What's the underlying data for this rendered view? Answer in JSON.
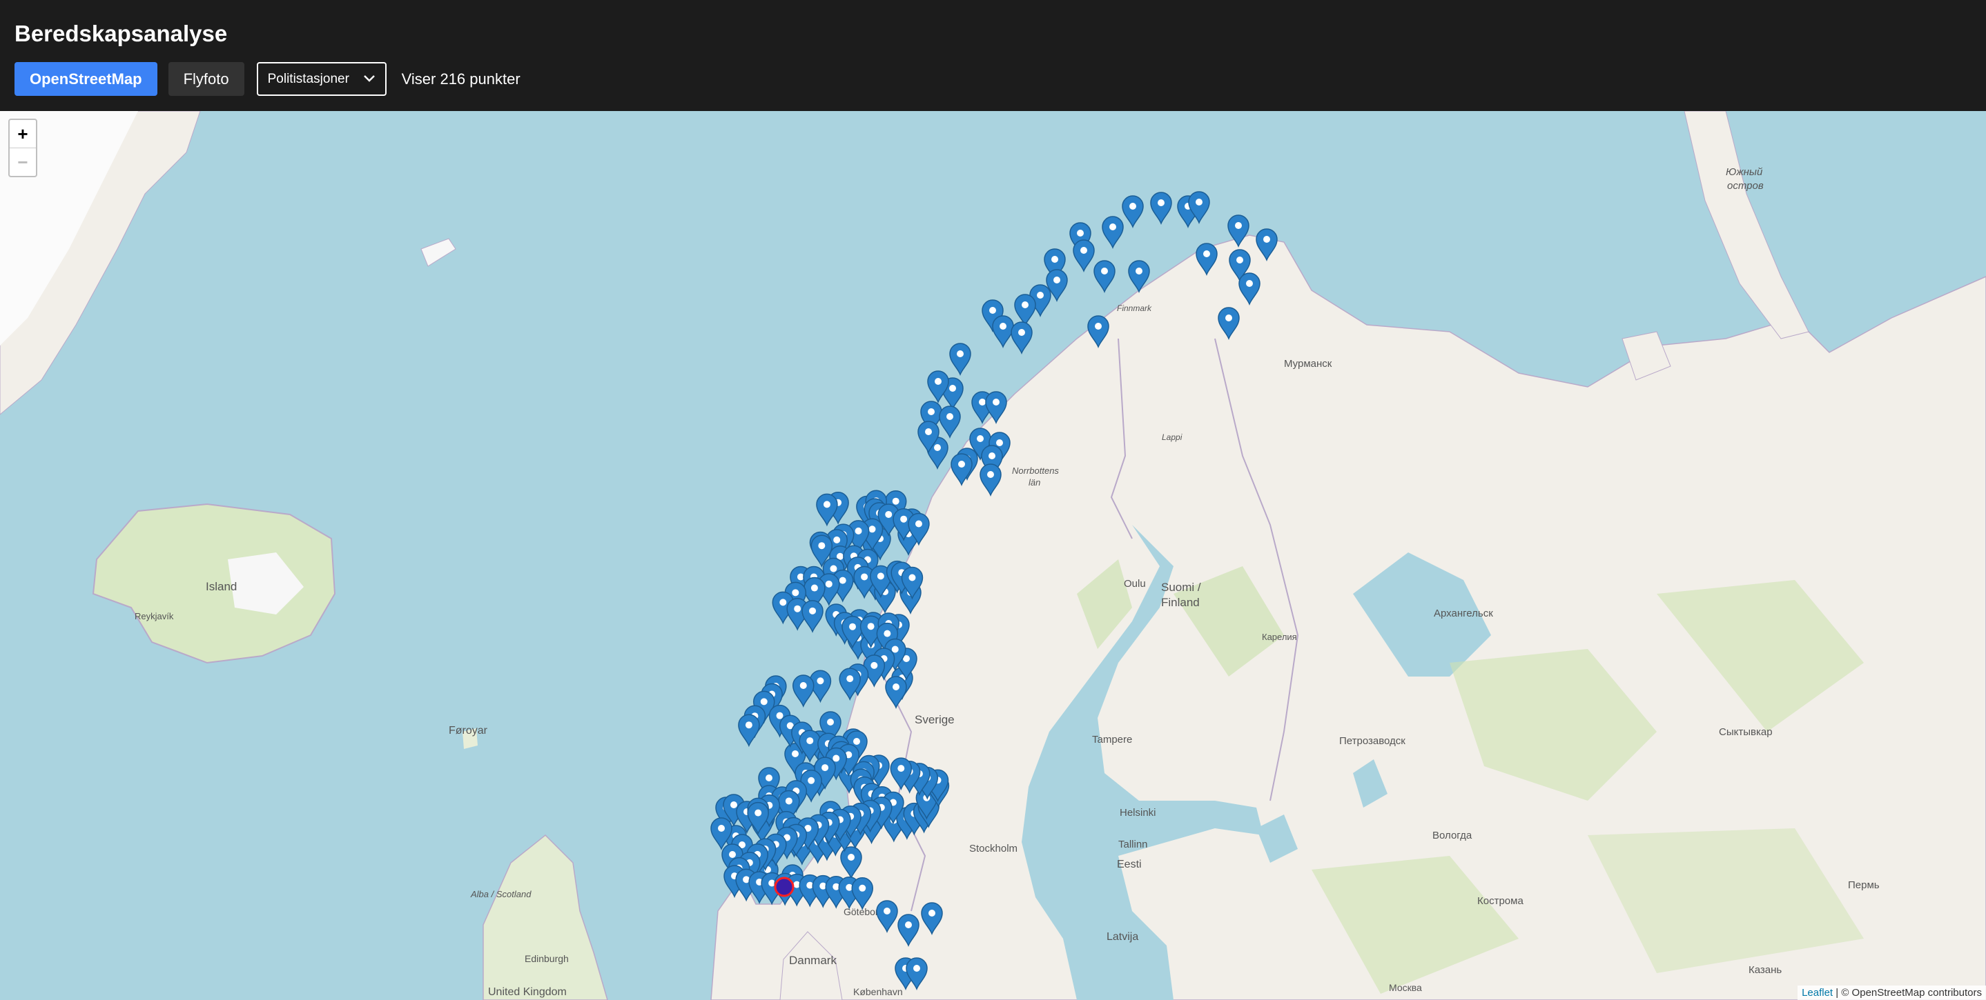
{
  "header": {
    "title": "Beredskapsanalyse",
    "btn_osm": "OpenStreetMap",
    "btn_aerial": "Flyfoto",
    "layer_select": "Politistasjoner",
    "point_count": "Viser 216 punkter"
  },
  "map": {
    "zoom_in": "+",
    "zoom_out": "−",
    "attribution_link": "Leaflet",
    "attribution_rest": " | © OpenStreetMap contributors",
    "labels": {
      "island": "Island",
      "reykjavik": "Reykjavík",
      "foroyar": "Føroyar",
      "alba": "Alba / Scotland",
      "edinburgh": "Edinburgh",
      "uk": "United Kingdom",
      "danmark": "Danmark",
      "kobenhavn": "København",
      "goteborg": "Göteborg",
      "sverige": "Sverige",
      "stockholm": "Stockholm",
      "suomi": "Suomi /",
      "finland": "Finland",
      "oulu": "Oulu",
      "tampere": "Tampere",
      "helsinki": "Helsinki",
      "tallinn": "Tallinn",
      "eesti": "Eesti",
      "latvija": "Latvija",
      "murmansk": "Мурманск",
      "arkhangelsk": "Архангельск",
      "petrozavodsk": "Петрозаводск",
      "syktyvkar": "Сыктывкар",
      "vologda": "Вологда",
      "perm": "Пермь",
      "yuzhny": "Южный",
      "ostrov": "остров",
      "finnmark": "Finnmark",
      "lappi": "Lappi",
      "norrbotten": "Norrbottens",
      "lan": "län",
      "karelia": "Карелия",
      "kostroma": "Кострома",
      "kazan": "Казань",
      "moskva": "Москва"
    },
    "selected_marker_color": "#3a1ea8",
    "marker_color": "#2a81cb"
  }
}
